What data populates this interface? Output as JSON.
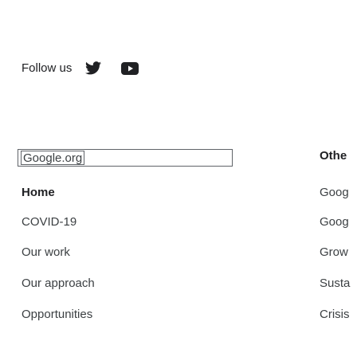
{
  "social": {
    "follow_label": "Follow us",
    "icons": [
      "twitter-icon",
      "youtube-icon"
    ]
  },
  "logo": {
    "text": "Google.org"
  },
  "nav_left": {
    "items": [
      {
        "label": "Home"
      },
      {
        "label": "COVID-19"
      },
      {
        "label": "Our work"
      },
      {
        "label": "Our approach"
      },
      {
        "label": "Opportunities"
      }
    ]
  },
  "nav_right": {
    "heading": "Othe",
    "items": [
      {
        "label": "Goog"
      },
      {
        "label": "Goog"
      },
      {
        "label": "Grow"
      },
      {
        "label": "Susta"
      },
      {
        "label": "Crisis"
      }
    ]
  },
  "colors": {
    "text": "#3c4043",
    "heading": "#202124",
    "icon": "#202124",
    "border": "#5f6368"
  }
}
